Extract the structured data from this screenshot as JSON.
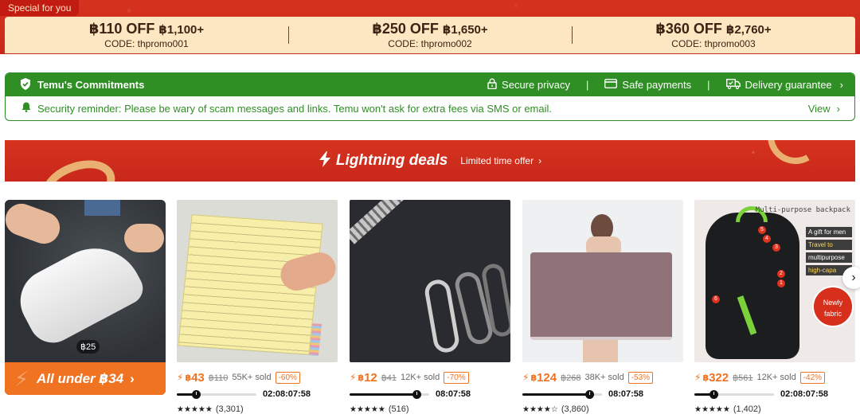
{
  "promo": {
    "tag": "Special for you",
    "coupons": [
      {
        "amount": "฿110 OFF",
        "min": "฿1,100+",
        "code": "CODE: thpromo001"
      },
      {
        "amount": "฿250 OFF",
        "min": "฿1,650+",
        "code": "CODE: thpromo002"
      },
      {
        "amount": "฿360 OFF",
        "min": "฿2,760+",
        "code": "CODE: thpromo003"
      }
    ]
  },
  "commitments": {
    "title": "Temu's Commitments",
    "items": [
      {
        "label": "Secure privacy",
        "icon": "lock-icon"
      },
      {
        "label": "Safe payments",
        "icon": "card-icon"
      },
      {
        "label": "Delivery guarantee",
        "icon": "truck-icon"
      }
    ],
    "separator": "|",
    "reminder": "Security reminder: Please be wary of scam messages and links. Temu won't ask for extra fees via SMS or email.",
    "view_label": "View",
    "colors": {
      "green": "#2f8f24"
    }
  },
  "lightning": {
    "title": "Lightning deals",
    "subtitle": "Limited time offer",
    "colors": {
      "red": "#d42e1c",
      "ribbon": "#e9b071"
    }
  },
  "promo_card": {
    "badge": "฿25",
    "label": "All under ฿34",
    "color": "#f07321"
  },
  "products": [
    {
      "name": "sticky notes",
      "currency": "฿",
      "price": "43",
      "original": "฿110",
      "sold": "55K+ sold",
      "discount": "-60%",
      "progress": 0.24,
      "timer": "02:08:07:58",
      "stars": "★★★★★",
      "reviews": "(3,301)"
    },
    {
      "name": "zipper pulls",
      "currency": "฿",
      "price": "12",
      "original": "฿41",
      "sold": "12K+ sold",
      "discount": "-70%",
      "progress": 0.84,
      "timer": "08:07:58",
      "stars": "★★★★★",
      "reviews": "(516)"
    },
    {
      "name": "wearable towel",
      "currency": "฿",
      "price": "124",
      "original": "฿268",
      "sold": "38K+ sold",
      "discount": "-53%",
      "progress": 0.84,
      "timer": "08:07:58",
      "stars": "★★★★☆",
      "reviews": "(3,860)"
    },
    {
      "name": "backpack",
      "currency": "฿",
      "price": "322",
      "original": "฿561",
      "sold": "12K+ sold",
      "discount": "-42%",
      "progress": 0.24,
      "timer": "02:08:07:58",
      "stars": "★★★★★",
      "reviews": "(1,402)",
      "image_text": {
        "title": "Multi-purpose backpack",
        "tags": [
          "A gift for men",
          "Travel to school",
          "multipurpose",
          "high-capa"
        ],
        "badge_line1": "Newly",
        "badge_line2": "fabric",
        "numbers": [
          "5",
          "4",
          "3",
          "2",
          "1",
          "6"
        ]
      }
    }
  ]
}
